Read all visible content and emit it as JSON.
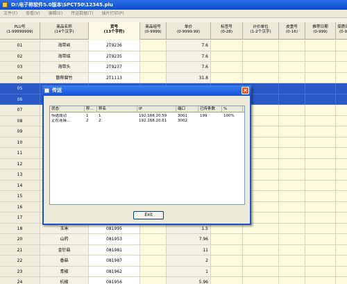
{
  "window": {
    "title": "D:\\电子称软件5.0版本\\SPCT50\\12345.plu"
  },
  "menu": [
    "文件(F)",
    "查看(V)",
    "编辑(E)",
    "传送数据(T)",
    "插片打印(P)"
  ],
  "columns": [
    {
      "l1": "PLU号",
      "l2": "(1-99999999)"
    },
    {
      "l1": "商品名称",
      "l2": "(14个汉字)"
    },
    {
      "l1": "货号",
      "l2": "(13个字符)"
    },
    {
      "l1": "商品组号",
      "l2": "(0-9999)"
    },
    {
      "l1": "单价",
      "l2": "(0-9999.99)"
    },
    {
      "l1": "标签号",
      "l2": "(0-28)"
    },
    {
      "l1": "计价单位",
      "l2": "(1-2个汉字)"
    },
    {
      "l1": "皮重号",
      "l2": "(0-16)"
    },
    {
      "l1": "推荐日期",
      "l2": "(0-999)"
    },
    {
      "l1": "保质日",
      "l2": "(0-9"
    }
  ],
  "rows": [
    {
      "num": "01",
      "name": "海带丝",
      "code": "2T9236",
      "price": "7.6"
    },
    {
      "num": "02",
      "name": "海带结",
      "code": "2T9235",
      "price": "7.6"
    },
    {
      "num": "03",
      "name": "海带头",
      "code": "2T9237",
      "price": "7.6"
    },
    {
      "num": "04",
      "name": "散称腐竹",
      "code": "2T1113",
      "price": "31.8"
    },
    {
      "num": "05",
      "name": "",
      "code": "",
      "price": ""
    },
    {
      "num": "06",
      "name": "",
      "code": "",
      "price": ""
    },
    {
      "num": "07",
      "name": "",
      "code": "",
      "price": ""
    },
    {
      "num": "08",
      "name": "",
      "code": "",
      "price": ""
    },
    {
      "num": "09",
      "name": "",
      "code": "",
      "price": ""
    },
    {
      "num": "10",
      "name": "",
      "code": "",
      "price": ""
    },
    {
      "num": "11",
      "name": "",
      "code": "",
      "price": ""
    },
    {
      "num": "12",
      "name": "",
      "code": "",
      "price": ""
    },
    {
      "num": "13",
      "name": "",
      "code": "",
      "price": ""
    },
    {
      "num": "14",
      "name": "",
      "code": "",
      "price": ""
    },
    {
      "num": "15",
      "name": "",
      "code": "",
      "price": ""
    },
    {
      "num": "16",
      "name": "",
      "code": "",
      "price": ""
    },
    {
      "num": "17",
      "name": "",
      "code": "",
      "price": ""
    },
    {
      "num": "18",
      "name": "玉米",
      "code": "081995",
      "price": "1.5"
    },
    {
      "num": "20",
      "name": "山药",
      "code": "081953",
      "price": "7.96"
    },
    {
      "num": "21",
      "name": "金针菇",
      "code": "081981",
      "price": "11"
    },
    {
      "num": "22",
      "name": "香菇",
      "code": "081987",
      "price": "2"
    },
    {
      "num": "23",
      "name": "青椒",
      "code": "081962",
      "price": "1"
    },
    {
      "num": "24",
      "name": "杭椒",
      "code": "081956",
      "price": "5.96"
    }
  ],
  "dialog": {
    "title": "传送",
    "close_label": "✕",
    "list_headers": [
      "状态",
      "秤...",
      "秤名",
      "IP",
      "端口",
      "已传条数",
      "%"
    ],
    "list_rows": [
      [
        "传送成功",
        "1",
        "1",
        "192.168.20.59",
        "3001",
        "199",
        "100%"
      ],
      [
        "正在连接...",
        "2",
        "2",
        "192.168.20.61",
        "3002",
        "",
        ""
      ]
    ],
    "exit_label": "Exit"
  }
}
